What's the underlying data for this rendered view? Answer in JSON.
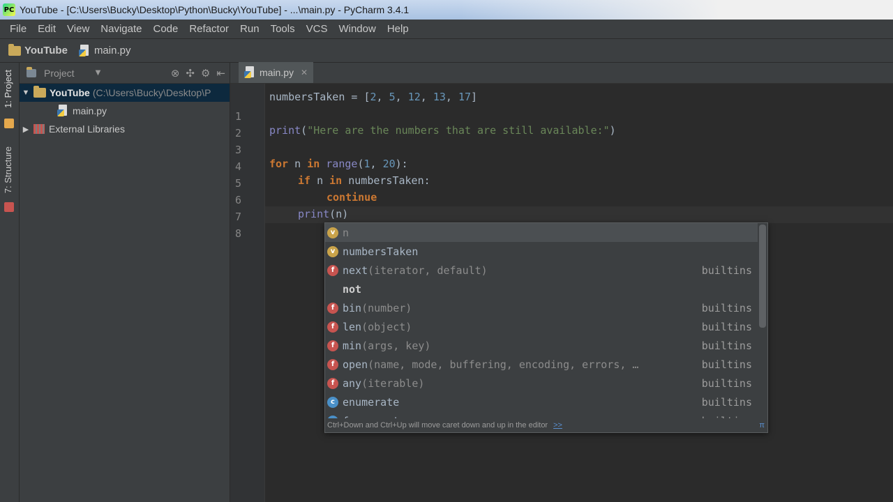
{
  "window": {
    "title": "YouTube - [C:\\Users\\Bucky\\Desktop\\Python\\Bucky\\YouTube] - ...\\main.py - PyCharm 3.4.1"
  },
  "menu": [
    "File",
    "Edit",
    "View",
    "Navigate",
    "Code",
    "Refactor",
    "Run",
    "Tools",
    "VCS",
    "Window",
    "Help"
  ],
  "navbar": {
    "project": "YouTube",
    "file": "main.py"
  },
  "toolstrip": {
    "project_tab": "1: Project",
    "structure_tab": "7: Structure"
  },
  "project_panel": {
    "title": "Project",
    "tree": [
      {
        "name": "YouTube",
        "path": "(C:\\Users\\Bucky\\Desktop\\P"
      },
      {
        "name": "main.py"
      },
      {
        "name": "External Libraries"
      }
    ]
  },
  "editor": {
    "tab_label": "main.py",
    "line_numbers": [
      "1",
      "2",
      "3",
      "4",
      "5",
      "6",
      "7",
      "8"
    ],
    "code": {
      "l1": {
        "var": "numbersTaken",
        "eq": " = ",
        "open": "[",
        "n1": "2",
        "n2": "5",
        "n3": "12",
        "n4": "13",
        "n5": "17",
        "sep": ", ",
        "close": "]"
      },
      "l3": {
        "fn": "print",
        "open": "(",
        "str": "\"Here are the numbers that are still available:\"",
        "close": ")"
      },
      "l5": {
        "kw1": "for",
        "var": " n ",
        "kw2": "in",
        "sp": " ",
        "fn": "range",
        "open": "(",
        "a": "1",
        "sep": ", ",
        "b": "20",
        "close": "):"
      },
      "l6": {
        "kw1": "if",
        "mid": " n ",
        "kw2": "in",
        "rest": " numbersTaken:"
      },
      "l7": {
        "kw": "continue"
      },
      "l8": {
        "fn": "print",
        "open": "(",
        "arg": "n",
        "close": ")"
      }
    }
  },
  "completion": {
    "items": [
      {
        "icon": "v",
        "name": "n",
        "params": "",
        "source": ""
      },
      {
        "icon": "v",
        "name": "numbersTaken",
        "params": "",
        "source": ""
      },
      {
        "icon": "f",
        "name": "next",
        "params": "(iterator, default)",
        "source": "builtins"
      },
      {
        "icon": "none",
        "name": "not",
        "params": "",
        "source": ""
      },
      {
        "icon": "f",
        "name": "bin",
        "params": "(number)",
        "source": "builtins"
      },
      {
        "icon": "f",
        "name": "len",
        "params": "(object)",
        "source": "builtins"
      },
      {
        "icon": "f",
        "name": "min",
        "params": "(args, key)",
        "source": "builtins"
      },
      {
        "icon": "f",
        "name": "open",
        "params": "(name, mode, buffering, encoding, errors, …",
        "source": "builtins"
      },
      {
        "icon": "f",
        "name": "any",
        "params": "(iterable)",
        "source": "builtins"
      },
      {
        "icon": "c",
        "name": "enumerate",
        "params": "",
        "source": "builtins"
      },
      {
        "icon": "c",
        "name": "frozenset",
        "params": "",
        "source": "builtins"
      }
    ],
    "footer": "Ctrl+Down and Ctrl+Up will move caret down and up in the editor",
    "footer_link": ">>",
    "pin": "π"
  }
}
